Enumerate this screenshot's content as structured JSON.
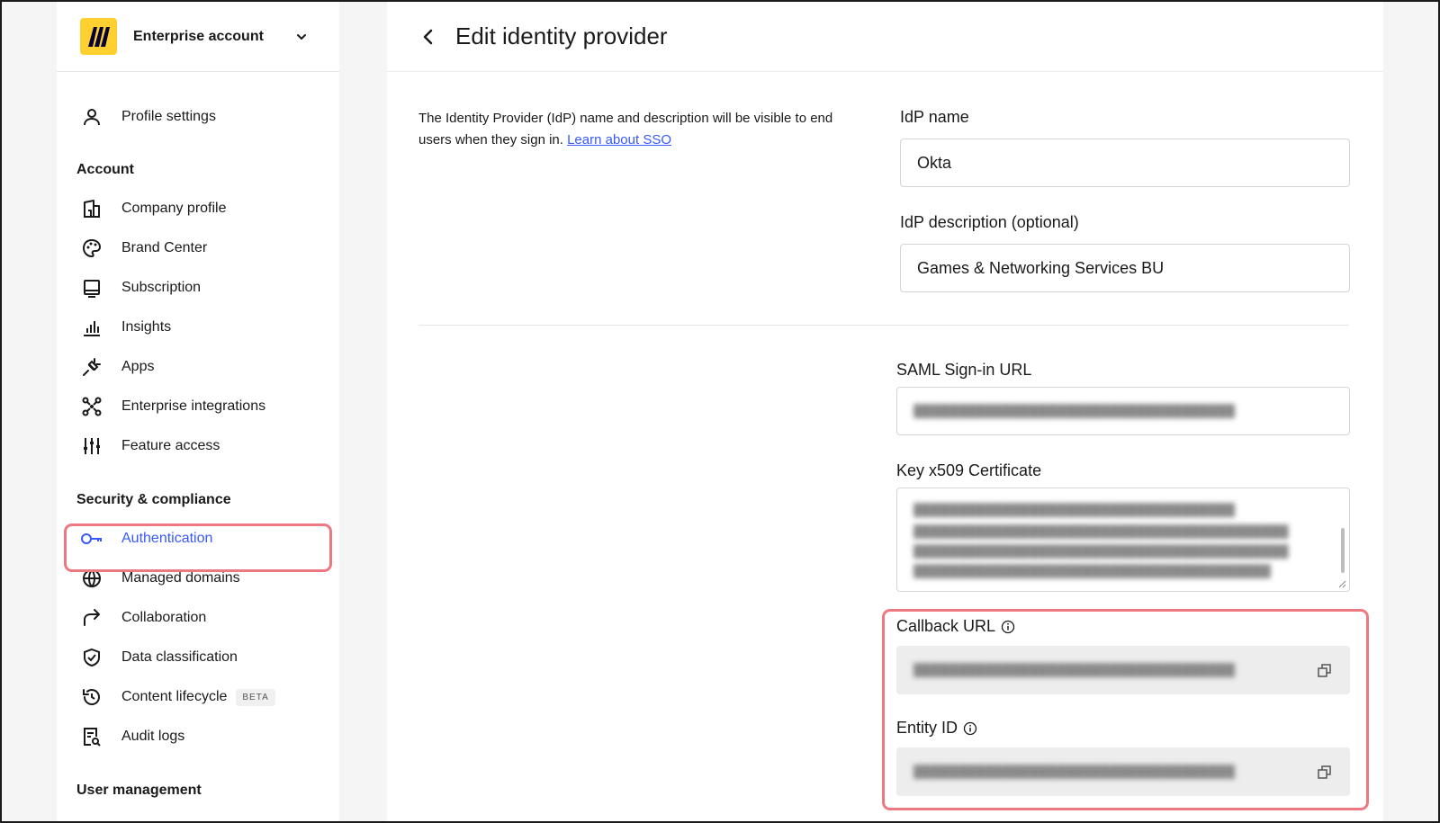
{
  "sidebar": {
    "account_name": "Enterprise account",
    "profile_settings": "Profile settings",
    "sections": {
      "account": "Account",
      "security": "Security & compliance",
      "user_management": "User management"
    },
    "account_items": [
      "Company profile",
      "Brand Center",
      "Subscription",
      "Insights",
      "Apps",
      "Enterprise integrations",
      "Feature access"
    ],
    "security_items": [
      "Authentication",
      "Managed domains",
      "Collaboration",
      "Data classification",
      "Content lifecycle",
      "Audit logs"
    ],
    "beta_badge": "BETA",
    "active_item": "Authentication"
  },
  "main": {
    "title": "Edit identity provider",
    "description": "The Identity Provider (IdP) name and description will be visible to end users when they sign in.",
    "learn_link": "Learn about SSO",
    "idp_name_label": "IdP name",
    "idp_name_value": "Okta",
    "idp_desc_label": "IdP description (optional)",
    "idp_desc_value": "Games & Networking Services BU",
    "saml_label": "SAML Sign-in URL",
    "cert_label": "Key x509 Certificate",
    "callback_label": "Callback URL",
    "entity_label": "Entity ID"
  },
  "colors": {
    "accent": "#3859ff",
    "highlight": "#ee7882",
    "logo": "#ffd02f"
  }
}
